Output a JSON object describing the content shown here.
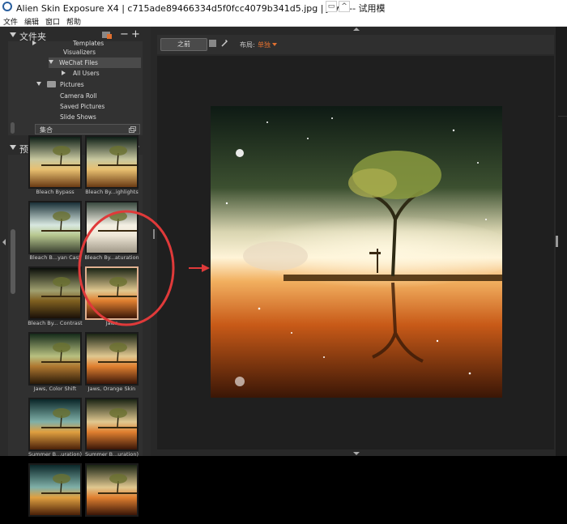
{
  "window": {
    "title": "Alien Skin Exposure X4 | c715ade89466334d5f0fcc4079b341d5.jpg | Jaws -- 试用模",
    "restore_glyph": "▭",
    "up_glyph": "^"
  },
  "menu": [
    "文件",
    "编辑",
    "窗口",
    "帮助"
  ],
  "folders": {
    "title": "文件夹",
    "items": [
      {
        "label": "Templates",
        "indent": 2
      },
      {
        "label": "Visualizers",
        "indent": 2
      },
      {
        "label": "WeChat Files",
        "indent": 1,
        "selected": true,
        "expanded": true
      },
      {
        "label": "All Users",
        "indent": 2,
        "collapsed": true
      },
      {
        "label": "Pictures",
        "indent": 0,
        "expanded": true,
        "folder_icon": true
      },
      {
        "label": "Camera Roll",
        "indent": 1
      },
      {
        "label": "Saved Pictures",
        "indent": 1
      },
      {
        "label": "Slide Shows",
        "indent": 1
      }
    ],
    "collection_label": "集合"
  },
  "presets": {
    "title": "预设",
    "items": [
      {
        "label": "Bleach Bypass",
        "tone": "top"
      },
      {
        "label": "Bleach By...ighlights",
        "tone": "top"
      },
      {
        "label": "Bleach B...yan Cast",
        "tone": "cyan"
      },
      {
        "label": "Bleach By...aturation",
        "tone": "white"
      },
      {
        "label": "Bleach By... Contrast",
        "tone": "dark"
      },
      {
        "label": "Jaws",
        "tone": "orange",
        "selected": true
      },
      {
        "label": "Jaws, Color Shift",
        "tone": "green"
      },
      {
        "label": "Jaws, Orange Skin",
        "tone": "orange"
      },
      {
        "label": "Summer B...uration)",
        "tone": "teal"
      },
      {
        "label": "Summer B...uration)",
        "tone": "orange"
      },
      {
        "label": "",
        "tone": "teal"
      },
      {
        "label": "",
        "tone": "orange"
      }
    ]
  },
  "toolbar": {
    "before_label": "之前",
    "layout_label": "布局:",
    "layout_value": "单独"
  },
  "colors": {
    "accent": "#e07030",
    "annotation_red": "#e03a3a",
    "panel": "#2b2b2b",
    "canvas": "#1f1f1f"
  }
}
